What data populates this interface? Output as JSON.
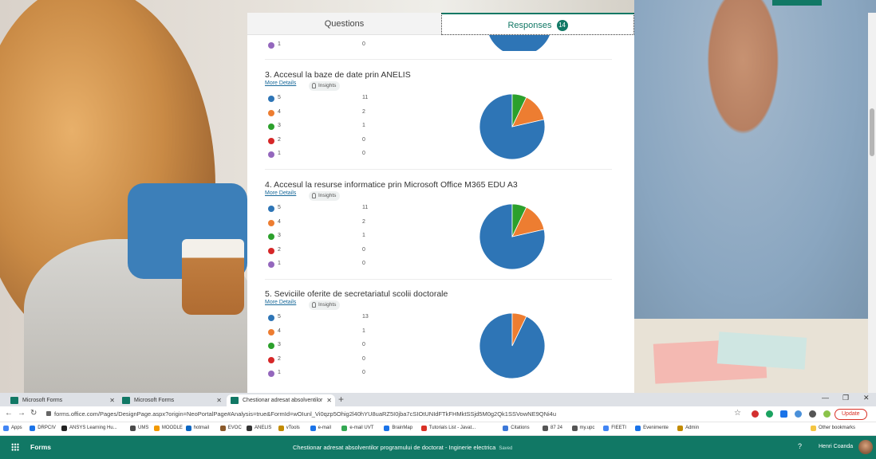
{
  "form": {
    "tabs": {
      "questions": "Questions",
      "responses": "Responses",
      "responses_count": "14"
    },
    "more_details_label": "More Details",
    "insights_label": "Insights",
    "options_colors": {
      "5": "#2e75b6",
      "4": "#ed7d31",
      "3": "#2ca02c",
      "2": "#d62728",
      "1": "#9467bd"
    },
    "partial_row": {
      "label": "1",
      "count": "0"
    },
    "questions": [
      {
        "title": "3. Accesul la baze de date prin ANELIS",
        "rows": [
          {
            "label": "5",
            "count": "11"
          },
          {
            "label": "4",
            "count": "2"
          },
          {
            "label": "3",
            "count": "1"
          },
          {
            "label": "2",
            "count": "0"
          },
          {
            "label": "1",
            "count": "0"
          }
        ]
      },
      {
        "title": "4. Accesul la resurse informatice prin Microsoft Office M365 EDU A3",
        "rows": [
          {
            "label": "5",
            "count": "11"
          },
          {
            "label": "4",
            "count": "2"
          },
          {
            "label": "3",
            "count": "1"
          },
          {
            "label": "2",
            "count": "0"
          },
          {
            "label": "1",
            "count": "0"
          }
        ]
      },
      {
        "title": "5. Seviciile oferite de secretariatul scolii doctorale",
        "rows": [
          {
            "label": "5",
            "count": "13"
          },
          {
            "label": "4",
            "count": "1"
          },
          {
            "label": "3",
            "count": "0"
          },
          {
            "label": "2",
            "count": "0"
          },
          {
            "label": "1",
            "count": "0"
          }
        ]
      }
    ]
  },
  "chart_data": [
    {
      "type": "pie",
      "categories": [
        "5",
        "4",
        "3",
        "2",
        "1"
      ],
      "values": [
        11,
        2,
        1,
        0,
        0
      ]
    },
    {
      "type": "pie",
      "categories": [
        "5",
        "4",
        "3",
        "2",
        "1"
      ],
      "values": [
        11,
        2,
        1,
        0,
        0
      ]
    },
    {
      "type": "pie",
      "categories": [
        "5",
        "4",
        "3",
        "2",
        "1"
      ],
      "values": [
        13,
        1,
        0,
        0,
        0
      ]
    }
  ],
  "browser": {
    "tabs": [
      {
        "title": "Microsoft Forms"
      },
      {
        "title": "Microsoft Forms"
      },
      {
        "title": "Chestionar adresat absolventilor"
      }
    ],
    "url": "forms.office.com/Pages/DesignPage.aspx?origin=NeoPortalPage#Analysis=true&FormId=wOIunl_Vi0qzp5Ohig2l40hYU8uaRZ5I0jba7cSIOtUNIdFTkFHMktSSjd5M0g2Qk1SSVowNE9QNi4u",
    "update_label": "Update",
    "bookmarks": [
      "Apps",
      "DRPCIV",
      "ANSYS Learning Hu...",
      "UMS",
      "MOODLE",
      "hotmail",
      "EVOC",
      "ANELIS",
      "vTools",
      "e-mail",
      "e-mail UVT",
      "BrainMap",
      "Tutorials List - Javat...",
      "Citations",
      "87 24",
      "my.upc",
      "FIEETI",
      "Evenimente",
      "Admin"
    ],
    "other_bookmarks": "Other bookmarks"
  },
  "forms_bar": {
    "app_name": "Forms",
    "doc_title": "Chestionar adresat absolventilor programului de doctorat - Inginerie electrica",
    "saved": "Saved",
    "help": "?",
    "user": "Henri Coanda"
  }
}
